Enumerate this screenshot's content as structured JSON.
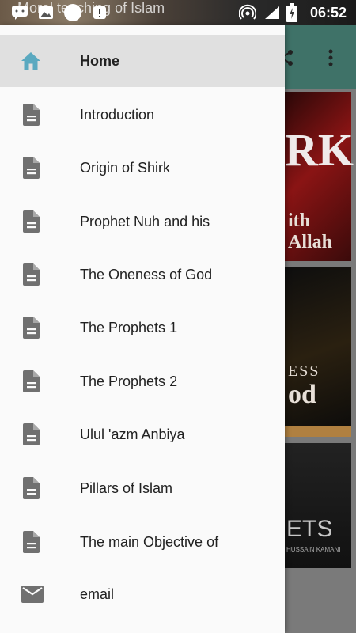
{
  "status_bar": {
    "app_title": "Moral teaching of Islam",
    "time": "06:52"
  },
  "app_behind": {
    "card1_text": "RK",
    "card1_sub": "ith Allah",
    "card2_text": "ESS",
    "card2_sub": "od",
    "card3_text": "ETS",
    "card3_sub": "HUSSAIN KAMANI"
  },
  "drawer": {
    "items": [
      {
        "label": "Home",
        "icon": "home-icon",
        "active": true
      },
      {
        "label": "Introduction",
        "icon": "document-icon"
      },
      {
        "label": "Origin of Shirk",
        "icon": "document-icon"
      },
      {
        "label": "Prophet Nuh and his",
        "icon": "document-icon"
      },
      {
        "label": "The Oneness of God",
        "icon": "document-icon"
      },
      {
        "label": "The Prophets 1",
        "icon": "document-icon"
      },
      {
        "label": "The Prophets 2",
        "icon": "document-icon"
      },
      {
        "label": "Ulul 'azm Anbiya",
        "icon": "document-icon"
      },
      {
        "label": "Pillars of Islam",
        "icon": "document-icon"
      },
      {
        "label": "The main Objective of",
        "icon": "document-icon"
      },
      {
        "label": "email",
        "icon": "mail-icon"
      }
    ]
  },
  "colors": {
    "home_icon": "#5aa9c0",
    "doc_icon": "#707070",
    "active_bg": "#e0e0e0",
    "toolbar": "#3f7268"
  }
}
